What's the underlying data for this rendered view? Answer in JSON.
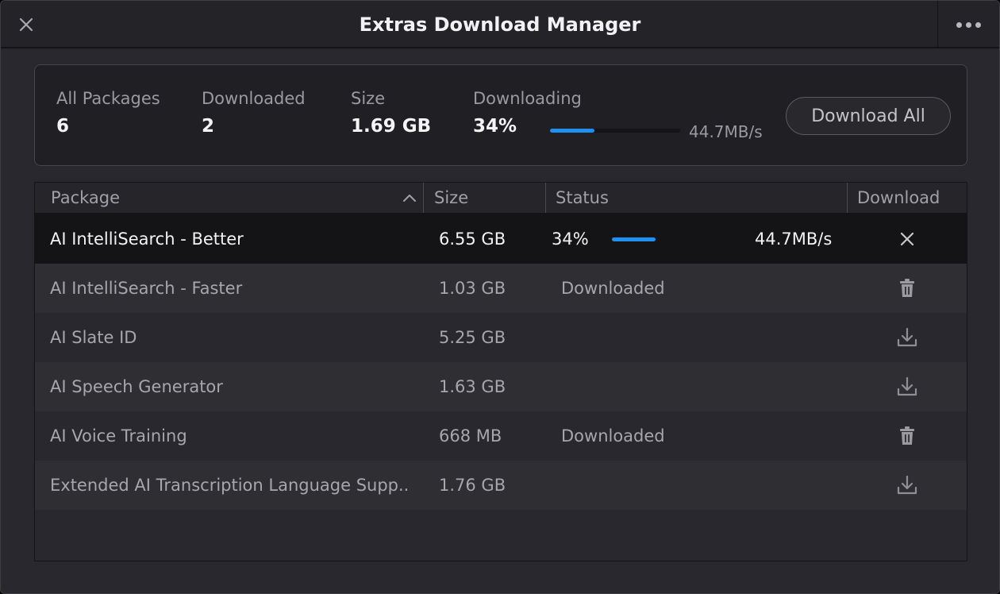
{
  "window": {
    "title": "Extras Download Manager"
  },
  "summary": {
    "all_packages_label": "All Packages",
    "all_packages_value": "6",
    "downloaded_label": "Downloaded",
    "downloaded_value": "2",
    "size_label": "Size",
    "size_value": "1.69 GB",
    "downloading_label": "Downloading",
    "downloading_value": "34%",
    "progress_fraction": 0.34,
    "rate": "44.7MB/s",
    "download_all_label": "Download All"
  },
  "table": {
    "headers": {
      "package": "Package",
      "size": "Size",
      "status": "Status",
      "download": "Download"
    },
    "sort": {
      "column": "package",
      "direction": "ascending"
    },
    "rows": [
      {
        "name": "AI IntelliSearch - Better",
        "size": "6.55 GB",
        "state": "downloading",
        "percent": "34%",
        "progress_fraction": 0.34,
        "rate": "44.7MB/s",
        "action_icon": "close-icon"
      },
      {
        "name": "AI IntelliSearch - Faster",
        "size": "1.03 GB",
        "state": "downloaded",
        "status": "Downloaded",
        "action_icon": "trash-icon"
      },
      {
        "name": "AI Slate ID",
        "size": "5.25 GB",
        "state": "available",
        "status": "",
        "action_icon": "download-icon"
      },
      {
        "name": "AI Speech Generator",
        "size": "1.63 GB",
        "state": "available",
        "status": "",
        "action_icon": "download-icon"
      },
      {
        "name": "AI Voice Training",
        "size": "668 MB",
        "state": "downloaded",
        "status": "Downloaded",
        "action_icon": "trash-icon"
      },
      {
        "name": "Extended AI Transcription Language Supp...",
        "size": "1.76 GB",
        "state": "available",
        "status": "",
        "action_icon": "download-icon"
      }
    ]
  },
  "colors": {
    "accent": "#1f8ff0",
    "background": "#28282e",
    "panel": "#1f1f24",
    "active_row": "#141417"
  }
}
